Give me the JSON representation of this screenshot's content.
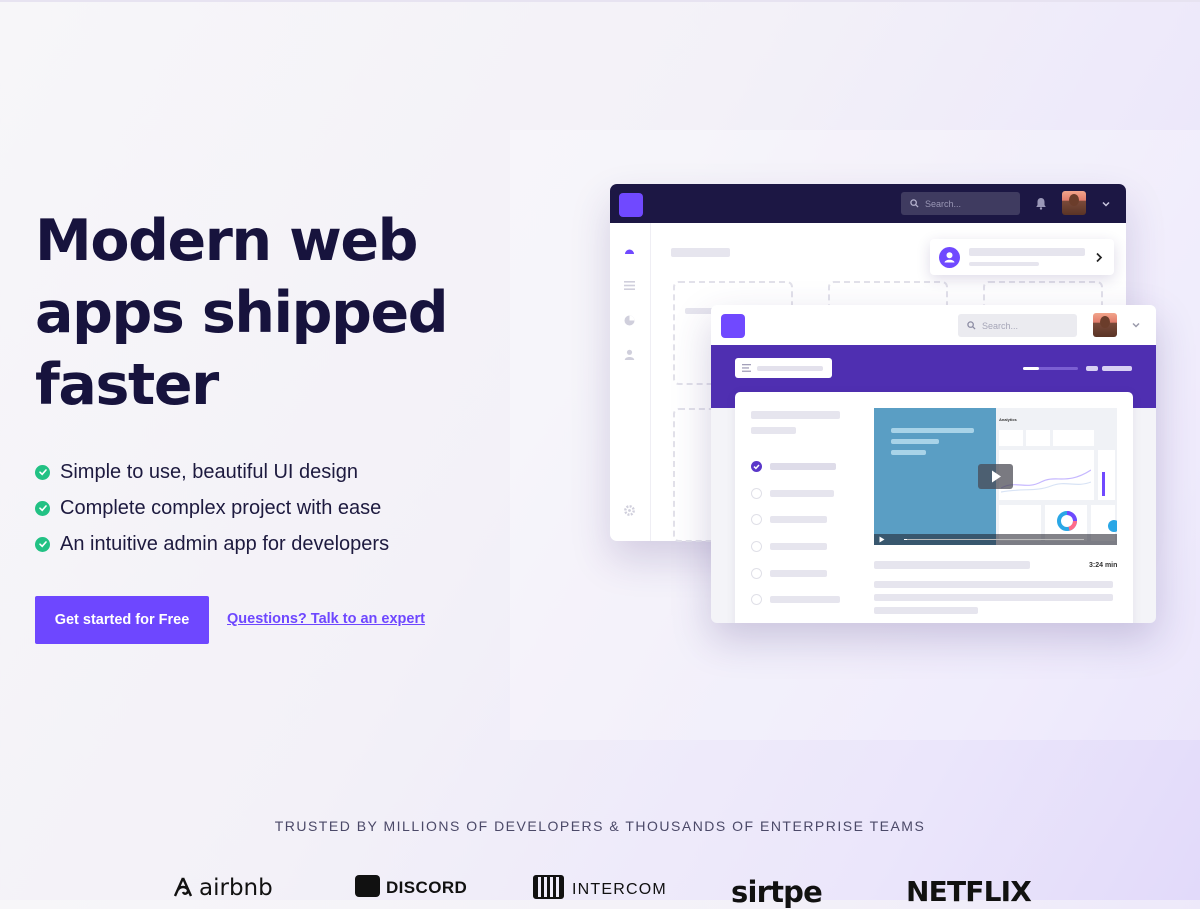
{
  "hero": {
    "title": "Modern web apps shipped faster",
    "features": [
      "Simple to use, beautiful UI design",
      "Complete complex project with ease",
      "An intuitive admin app for developers"
    ],
    "cta_primary": "Get started for Free",
    "cta_secondary": "Questions? Talk to an expert"
  },
  "illustration": {
    "back_window": {
      "search_placeholder": "Search..."
    },
    "front_window": {
      "search_placeholder": "Search...",
      "video_duration": "3:24 min",
      "video_section_label": "Analytics"
    },
    "colors": {
      "accent": "#6e47ff",
      "dark_bar": "#1c1744",
      "band": "#4f2fb1",
      "check_green": "#22c184"
    },
    "icons": [
      "search-icon",
      "bell-icon",
      "chevron-down-icon",
      "dashboard-icon",
      "list-icon",
      "pie-chart-icon",
      "user-icon",
      "gear-icon",
      "play-icon",
      "chevron-right-icon"
    ]
  },
  "trusted": {
    "heading": "TRUSTED BY MILLIONS OF DEVELOPERS & THOUSANDS OF ENTERPRISE TEAMS",
    "logos": [
      "airbnb",
      "DISCORD",
      "INTERCOM",
      "sirtpe",
      "NETFLIX"
    ]
  }
}
